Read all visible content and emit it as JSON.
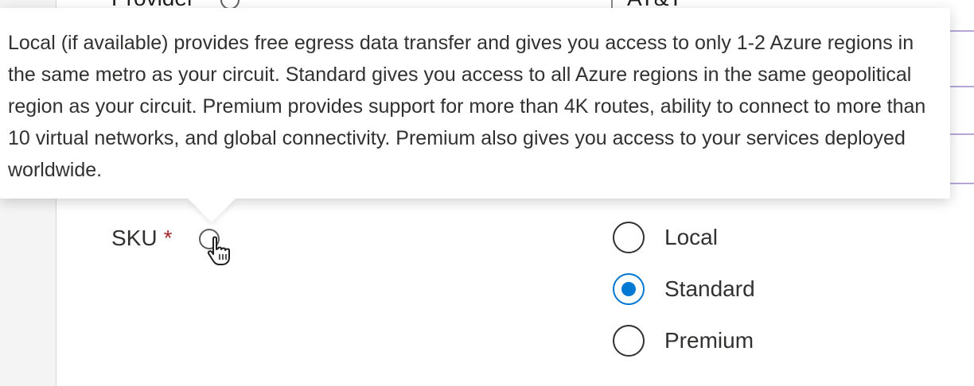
{
  "form": {
    "provider_label": "Provider",
    "provider_value": "AT&T",
    "required_mark": "*",
    "sku_label": "SKU"
  },
  "tooltip": {
    "text": "Local (if available) provides free egress data transfer and gives you access to only 1-2 Azure regions in the same metro as your circuit. Standard gives you access to all Azure regions in the same geopolitical region as your circuit. Premium provides support for more than 4K routes, ability to connect to more than 10 virtual networks, and global connectivity. Premium also gives you access to your services deployed worldwide."
  },
  "sku_options": [
    {
      "label": "Local",
      "selected": false
    },
    {
      "label": "Standard",
      "selected": true
    },
    {
      "label": "Premium",
      "selected": false
    }
  ],
  "icons": {
    "info": "info-icon",
    "cursor": "hand-pointer-icon"
  },
  "colors": {
    "accent": "#0078d4",
    "required": "#a4262c"
  }
}
